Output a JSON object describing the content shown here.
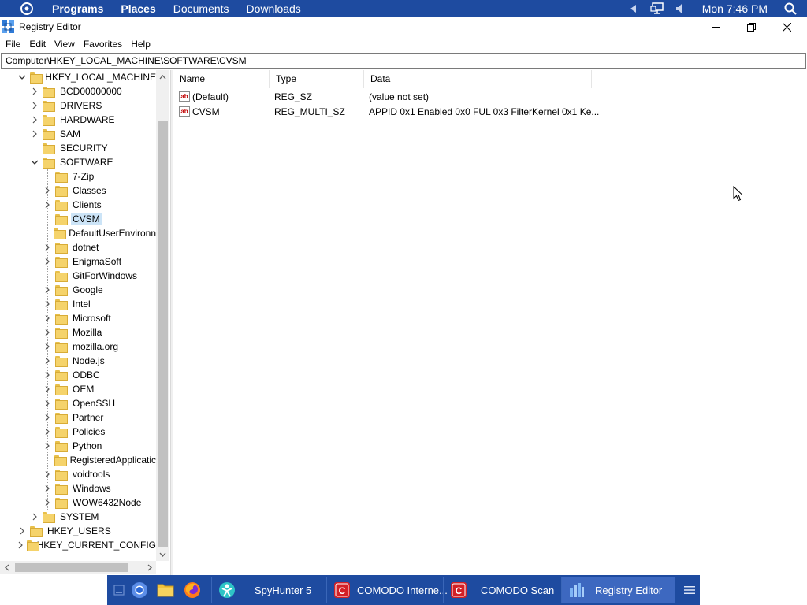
{
  "top_panel": {
    "menus": [
      "Programs",
      "Places",
      "Documents",
      "Downloads"
    ],
    "clock": "Mon 7:46 PM"
  },
  "window": {
    "title": "Registry Editor",
    "menu": [
      "File",
      "Edit",
      "View",
      "Favorites",
      "Help"
    ],
    "address": "Computer\\HKEY_LOCAL_MACHINE\\SOFTWARE\\CVSM"
  },
  "tree": {
    "root": "HKEY_LOCAL_MACHINE",
    "hklm_children": [
      "BCD00000000",
      "DRIVERS",
      "HARDWARE",
      "SAM",
      "SECURITY",
      "SOFTWARE"
    ],
    "software_children": [
      "7-Zip",
      "Classes",
      "Clients",
      "CVSM",
      "DefaultUserEnvironn",
      "dotnet",
      "EnigmaSoft",
      "GitForWindows",
      "Google",
      "Intel",
      "Microsoft",
      "Mozilla",
      "mozilla.org",
      "Node.js",
      "ODBC",
      "OEM",
      "OpenSSH",
      "Partner",
      "Policies",
      "Python",
      "RegisteredApplicatic",
      "voidtools",
      "Windows",
      "WOW6432Node"
    ],
    "after_software": "SYSTEM",
    "other_roots": [
      "HKEY_USERS",
      "HKEY_CURRENT_CONFIG"
    ],
    "selected": "CVSM"
  },
  "values": {
    "columns": [
      "Name",
      "Type",
      "Data"
    ],
    "rows": [
      {
        "name": "(Default)",
        "type": "REG_SZ",
        "data": "(value not set)"
      },
      {
        "name": "CVSM",
        "type": "REG_MULTI_SZ",
        "data": "APPID 0x1 Enabled 0x0 FUL 0x3 FilterKernel 0x1 Ke..."
      }
    ],
    "icon_text": "ab"
  },
  "taskbar": {
    "tasks": [
      "SpyHunter 5",
      "COMODO Interne...",
      "COMODO Scan",
      "Registry Editor"
    ],
    "active": "Registry Editor"
  },
  "colors": {
    "panel": "#1e4ba0",
    "selection": "#cce4f7",
    "folder": "#f5d36b"
  }
}
